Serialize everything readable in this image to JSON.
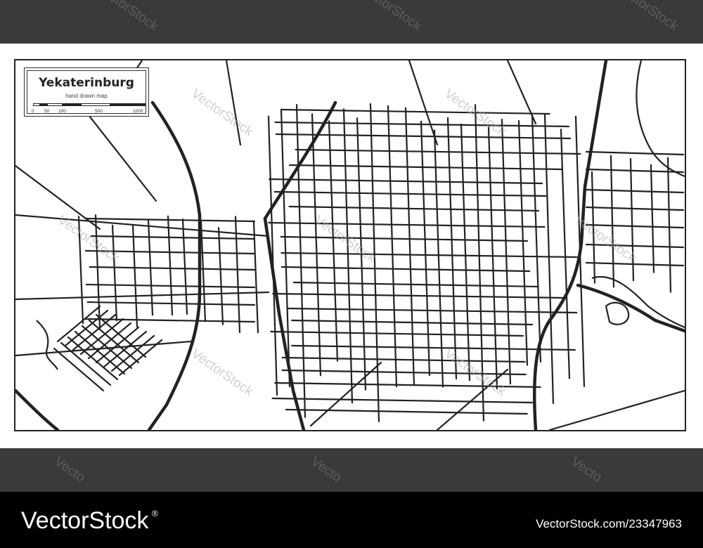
{
  "map": {
    "title": "Yekaterinburg",
    "subtitle": "hand drawn map",
    "scale_ticks": [
      "0",
      "50",
      "100",
      "500",
      "1000"
    ]
  },
  "watermark": {
    "text": "VectorStock",
    "short": "Vecto"
  },
  "footer": {
    "brand": "VectorStock",
    "brand_mark": "®",
    "image_id": "VectorStock.com/23347963"
  },
  "colors": {
    "road": "#222222",
    "background": "#ffffff",
    "band": "#3a3a3a",
    "footer": "#000000"
  }
}
